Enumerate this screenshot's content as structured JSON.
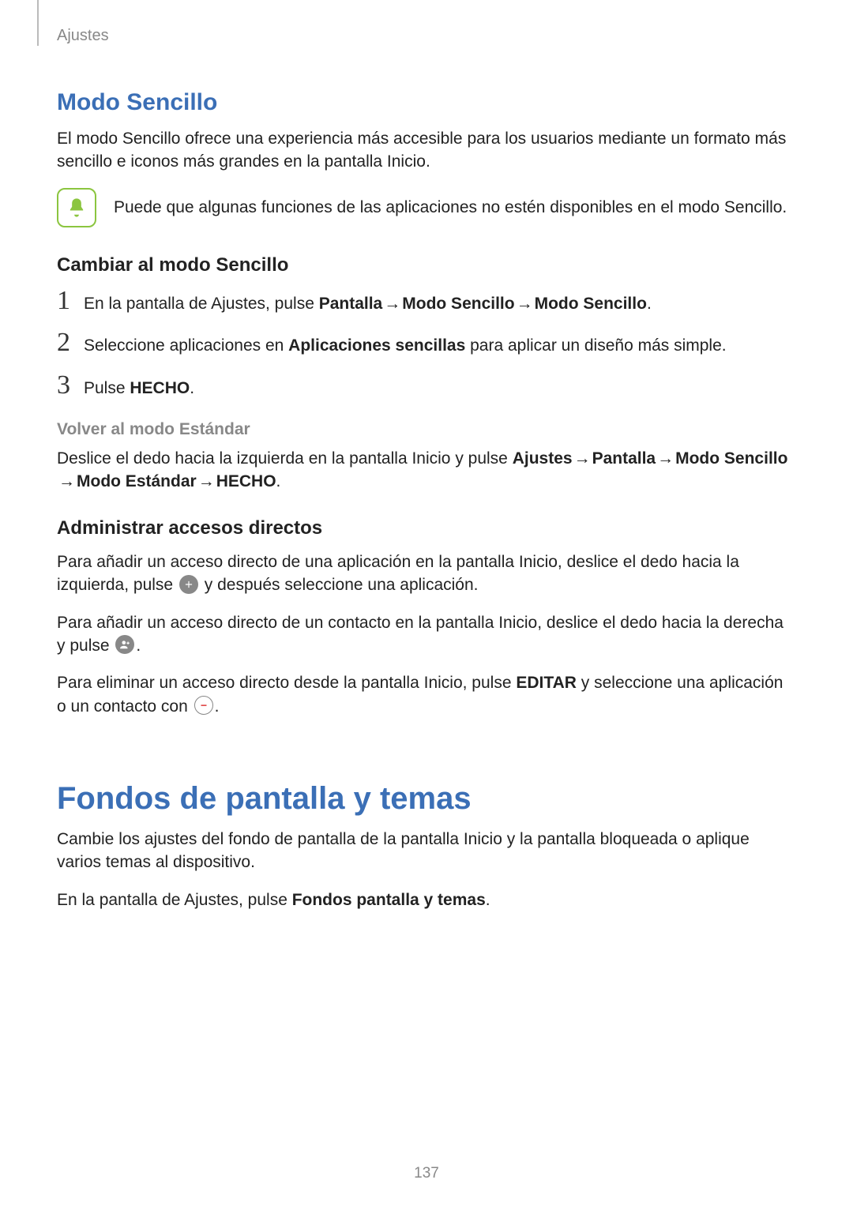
{
  "header": {
    "breadcrumb": "Ajustes"
  },
  "section1": {
    "title": "Modo Sencillo",
    "intro": "El modo Sencillo ofrece una experiencia más accesible para los usuarios mediante un formato más sencillo e iconos más grandes en la pantalla Inicio.",
    "note": "Puede que algunas funciones de las aplicaciones no estén disponibles en el modo Sencillo.",
    "sub1": {
      "title": "Cambiar al modo Sencillo",
      "steps": {
        "n1": "1",
        "s1a": "En la pantalla de Ajustes, pulse ",
        "s1b": "Pantalla",
        "arrow": " → ",
        "s1c": "Modo Sencillo",
        "s1d": "Modo Sencillo",
        "s1e": ".",
        "n2": "2",
        "s2a": "Seleccione aplicaciones en ",
        "s2b": "Aplicaciones sencillas",
        "s2c": " para aplicar un diseño más simple.",
        "n3": "3",
        "s3a": "Pulse ",
        "s3b": "HECHO",
        "s3c": "."
      }
    },
    "sub2": {
      "title": "Volver al modo Estándar",
      "p_a": "Deslice el dedo hacia la izquierda en la pantalla Inicio y pulse ",
      "p_b": "Ajustes",
      "arrow": " → ",
      "p_c": "Pantalla",
      "p_d": "Modo Sencillo",
      "p_e": "Modo Estándar",
      "p_f": "HECHO",
      "p_g": "."
    },
    "sub3": {
      "title": "Administrar accesos directos",
      "p1a": "Para añadir un acceso directo de una aplicación en la pantalla Inicio, deslice el dedo hacia la izquierda, pulse ",
      "p1b": " y después seleccione una aplicación.",
      "p2a": "Para añadir un acceso directo de un contacto en la pantalla Inicio, deslice el dedo hacia la derecha y pulse ",
      "p2b": ".",
      "p3a": "Para eliminar un acceso directo desde la pantalla Inicio, pulse ",
      "p3b": "EDITAR",
      "p3c": " y seleccione una aplicación o un contacto con ",
      "p3d": "."
    }
  },
  "section2": {
    "title": "Fondos de pantalla y temas",
    "p1": "Cambie los ajustes del fondo de pantalla de la pantalla Inicio y la pantalla bloqueada o aplique varios temas al dispositivo.",
    "p2a": "En la pantalla de Ajustes, pulse ",
    "p2b": "Fondos pantalla y temas",
    "p2c": "."
  },
  "page_number": "137"
}
